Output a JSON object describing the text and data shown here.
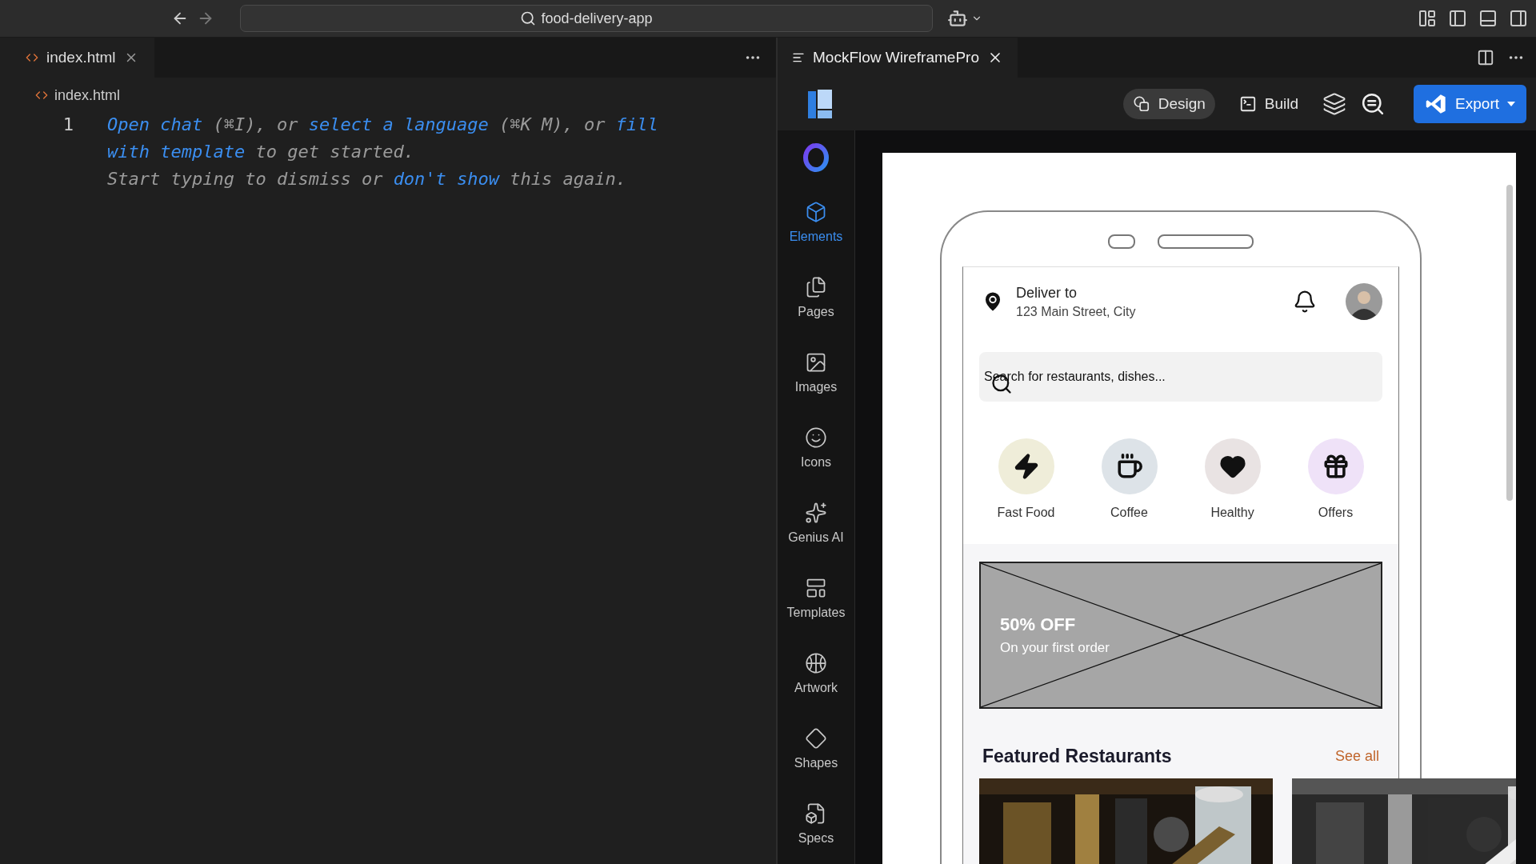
{
  "title_bar": {
    "search": "food-delivery-app"
  },
  "editor": {
    "tab": {
      "label": "index.html",
      "selected": true
    },
    "breadcrumb": "index.html",
    "line_number": "1",
    "hint_lines": [
      [
        {
          "kind": "link",
          "text": "Open chat"
        },
        {
          "kind": "text",
          "text": " (⌘I), or "
        },
        {
          "kind": "link",
          "text": "select a language"
        },
        {
          "kind": "text",
          "text": " (⌘K M), or "
        },
        {
          "kind": "link",
          "text": "fill"
        }
      ],
      [
        {
          "kind": "link",
          "text": "with template"
        },
        {
          "kind": "text",
          "text": " to get started."
        }
      ],
      [
        {
          "kind": "text",
          "text": "Start typing to dismiss or "
        },
        {
          "kind": "link",
          "text": "don't show"
        },
        {
          "kind": "text",
          "text": " this again."
        }
      ]
    ]
  },
  "panel": {
    "tab": {
      "label": "MockFlow WireframePro",
      "selected": true
    },
    "toolbar": [
      {
        "kind": "design",
        "label": "Design",
        "selected": true
      },
      {
        "kind": "build",
        "label": "Build",
        "selected": false
      }
    ],
    "export_button": "Export",
    "sidebar": [
      {
        "kind": "elements",
        "label": "Elements",
        "selected": true
      },
      {
        "kind": "pages",
        "label": "Pages",
        "selected": false
      },
      {
        "kind": "images",
        "label": "Images",
        "selected": false
      },
      {
        "kind": "icons",
        "label": "Icons",
        "selected": false
      },
      {
        "kind": "genius",
        "label": "Genius AI",
        "selected": false
      },
      {
        "kind": "templates",
        "label": "Templates",
        "selected": false
      },
      {
        "kind": "artwork",
        "label": "Artwork",
        "selected": false
      },
      {
        "kind": "shapes",
        "label": "Shapes",
        "selected": false
      },
      {
        "kind": "specs",
        "label": "Specs",
        "selected": false
      }
    ]
  },
  "phone": {
    "deliver_label": "Deliver to",
    "address": "123 Main Street, City",
    "search": {
      "placeholder": "Search for restaurants, dishes..."
    },
    "categories": [
      {
        "kind": "fast-food",
        "label": "Fast Food",
        "color": "#efedd9"
      },
      {
        "kind": "coffee",
        "label": "Coffee",
        "color": "#dde3e8"
      },
      {
        "kind": "healthy",
        "label": "Healthy",
        "color": "#e9e3e3"
      },
      {
        "kind": "offers",
        "label": "Offers",
        "color": "#efe2f8"
      }
    ],
    "banner": {
      "title": "50% OFF",
      "subtitle": "On your first order"
    },
    "section_title": "Featured Restaurants",
    "see_all": "See all"
  }
}
